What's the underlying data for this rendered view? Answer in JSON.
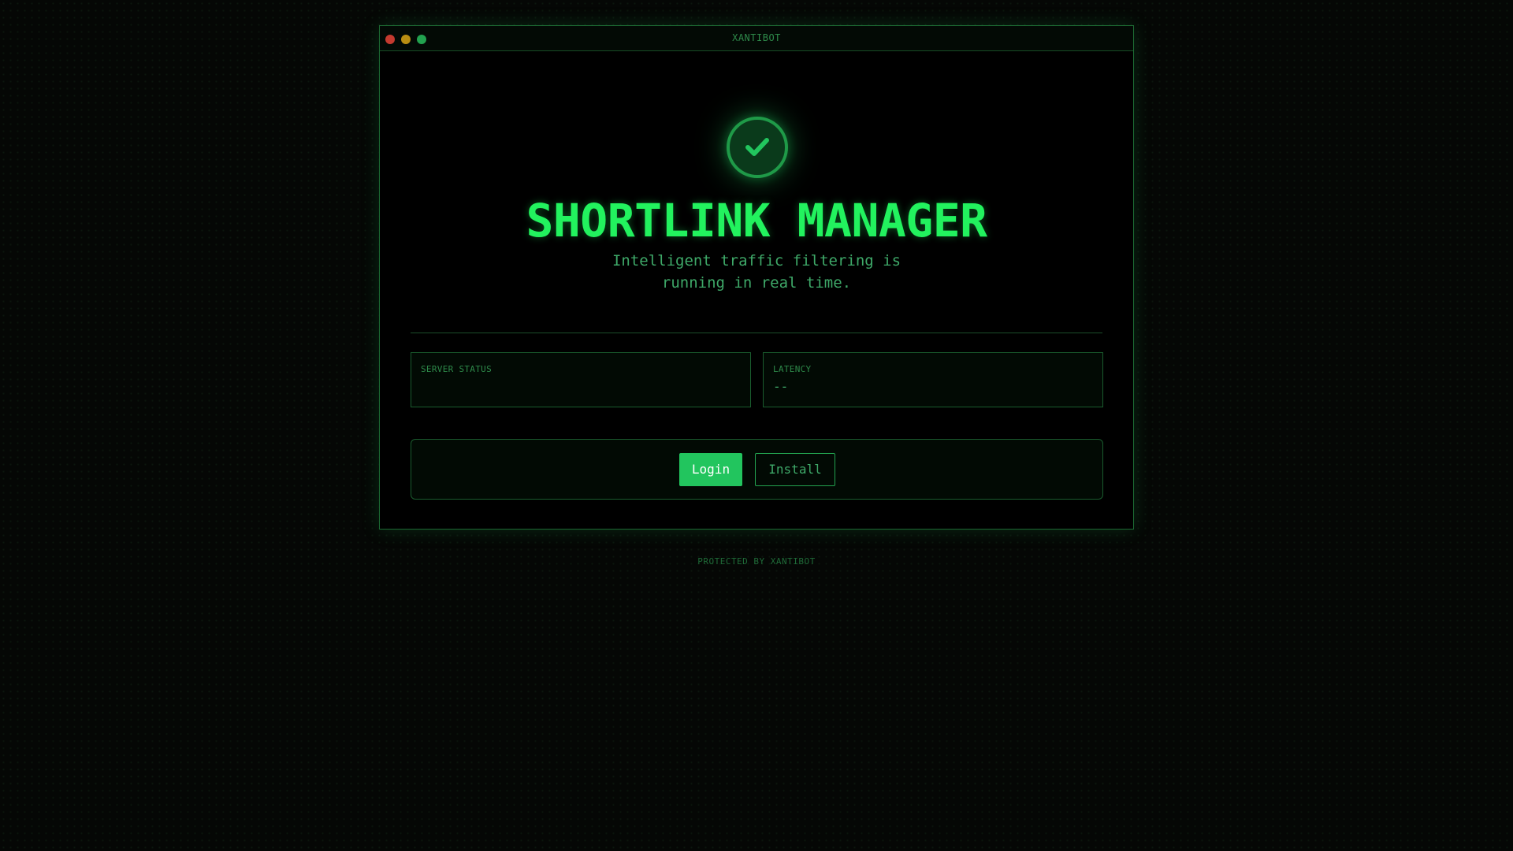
{
  "window": {
    "title": "XANTIBOT",
    "controls": [
      "close",
      "minimize",
      "maximize"
    ]
  },
  "hero": {
    "icon": "check-circle-icon",
    "title": "SHORTLINK MANAGER",
    "subtitle": "Intelligent traffic filtering is running in real time."
  },
  "stats": {
    "server_status": {
      "label": "SERVER STATUS",
      "value": ""
    },
    "latency": {
      "label": "LATENCY",
      "value": "--"
    }
  },
  "actions": {
    "login_label": "Login",
    "install_label": "Install"
  },
  "footer": {
    "text": "PROTECTED BY XANTIBOT"
  },
  "colors": {
    "accent": "#22c55e",
    "title": "#22f25e",
    "close_dot": "#c53a2f",
    "minimize_dot": "#b98e12",
    "maximize_dot": "#22a24f"
  }
}
